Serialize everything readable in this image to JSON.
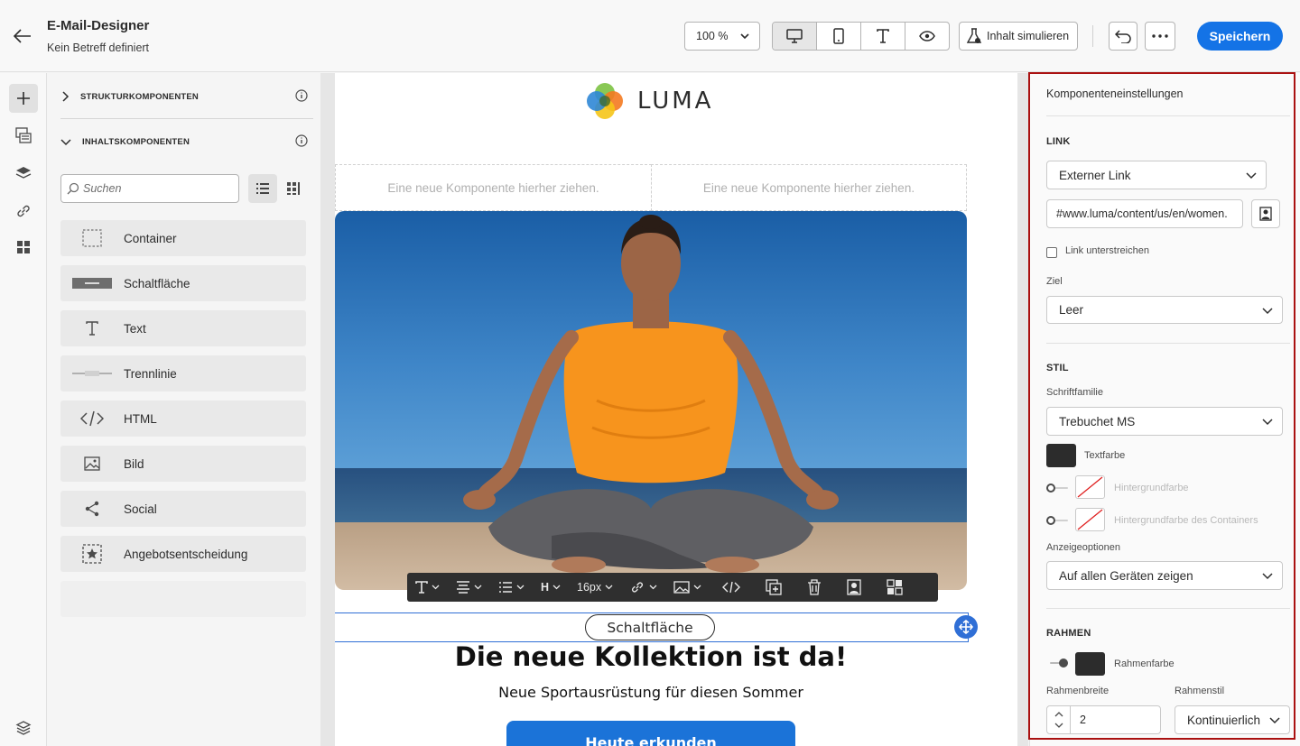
{
  "header": {
    "title": "E-Mail-Designer",
    "subtitle": "Kein Betreff definiert",
    "zoom": "100 %",
    "simulate_label": "Inhalt simulieren",
    "save_label": "Speichern"
  },
  "components_panel": {
    "structure_label": "STRUKTURKOMPONENTEN",
    "content_label": "INHALTSKOMPONENTEN",
    "search_placeholder": "Suchen",
    "items": [
      {
        "label": "Container",
        "icon": "container-icon"
      },
      {
        "label": "Schaltfläche",
        "icon": "button-icon"
      },
      {
        "label": "Text",
        "icon": "text-icon"
      },
      {
        "label": "Trennlinie",
        "icon": "divider-icon"
      },
      {
        "label": "HTML",
        "icon": "code-icon"
      },
      {
        "label": "Bild",
        "icon": "image-icon"
      },
      {
        "label": "Social",
        "icon": "share-icon"
      },
      {
        "label": "Angebotsentscheidung",
        "icon": "offer-decision-icon"
      }
    ]
  },
  "canvas": {
    "logo_text": "LUMA",
    "drop_zone_text": "Eine neue Komponente hierher ziehen.",
    "toolbar": {
      "heading": "H",
      "font_size": "16px"
    },
    "button_text": "Schaltfläche",
    "headline": "Die neue Kollektion ist da!",
    "subline": "Neue Sportausrüstung für diesen Sommer",
    "cta_text": "Heute erkunden"
  },
  "settings": {
    "title": "Komponenteneinstellungen",
    "link": {
      "section": "LINK",
      "type": "Externer Link",
      "url": "#www.luma/content/us/en/women.",
      "underline_label": "Link unterstreichen",
      "target_label": "Ziel",
      "target_value": "Leer"
    },
    "style": {
      "section": "STIL",
      "font_family_label": "Schriftfamilie",
      "font_family_value": "Trebuchet MS",
      "text_color_label": "Textfarbe",
      "bg_color_label": "Hintergrundfarbe",
      "container_bg_label": "Hintergrundfarbe des Containers",
      "display_label": "Anzeigeoptionen",
      "display_value": "Auf allen Geräten zeigen"
    },
    "border": {
      "section": "RAHMEN",
      "color_label": "Rahmenfarbe",
      "width_label": "Rahmenbreite",
      "style_label": "Rahmenstil",
      "width_value": "2",
      "style_value": "Kontinuierlich"
    }
  },
  "colors": {
    "accent": "#1473e6",
    "selection": "#2f6fd6",
    "highlight_frame": "#aa1111",
    "text_swatch": "#2c2c2c",
    "border_swatch": "#2c2c2c"
  }
}
